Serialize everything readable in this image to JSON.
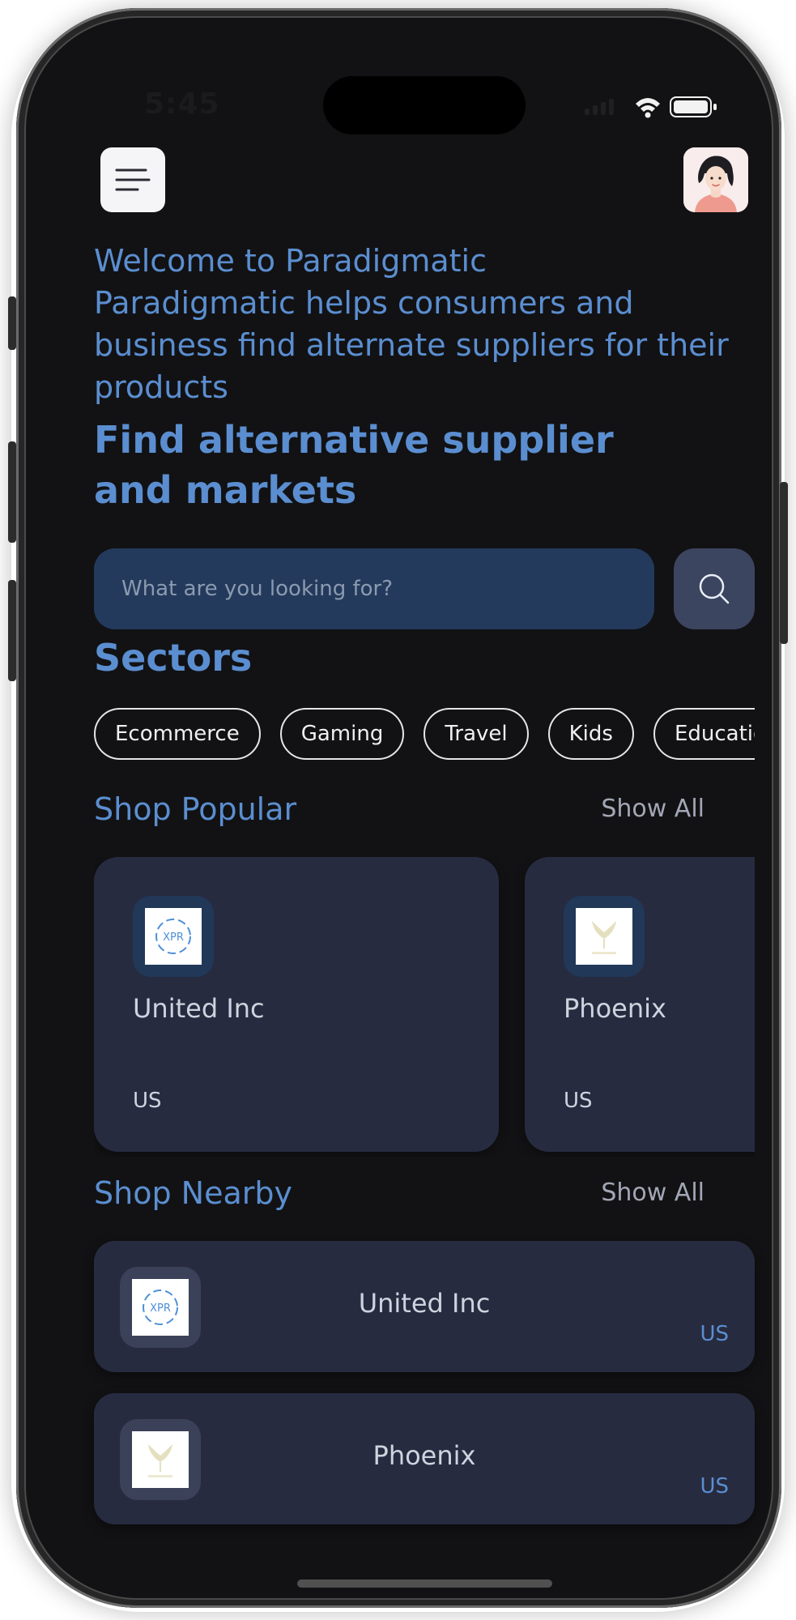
{
  "status_bar": {
    "time": "5:45",
    "wifi_icon": "wifi-icon",
    "battery_icon": "battery-icon"
  },
  "header": {
    "menu_icon": "menu-icon",
    "avatar_icon": "user-avatar"
  },
  "welcome": {
    "title": "Welcome to Paradigmatic",
    "description": "Paradigmatic helps consumers and business find alternate suppliers for their products"
  },
  "headline": "Find alternative supplier and markets",
  "search": {
    "placeholder": "What are you looking for?",
    "value": "",
    "icon": "search-icon"
  },
  "sectors": {
    "title": "Sectors",
    "items": [
      "Ecommerce",
      "Gaming",
      "Travel",
      "Kids",
      "Education"
    ]
  },
  "shop_popular": {
    "title": "Shop Popular",
    "show_all": "Show All",
    "items": [
      {
        "name": "United Inc",
        "country": "US",
        "logo_text": "XPR"
      },
      {
        "name": "Phoenix",
        "country": "US"
      }
    ]
  },
  "shop_nearby": {
    "title": "Shop Nearby",
    "show_all": "Show All",
    "items": [
      {
        "name": "United Inc",
        "country": "US",
        "logo_text": "XPR"
      },
      {
        "name": "Phoenix",
        "country": "US"
      }
    ]
  },
  "colors": {
    "background": "#121214",
    "accent": "#5b8ed0",
    "search_field": "#233a5c",
    "card": "#272b40"
  }
}
